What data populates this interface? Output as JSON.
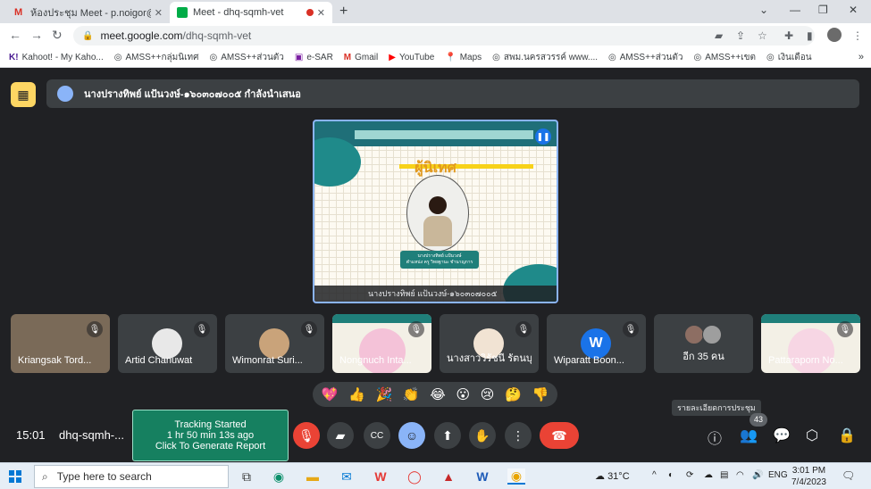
{
  "browser": {
    "tabs": [
      {
        "title": "ห้องประชุม Meet - p.noigor@gmail",
        "active": false
      },
      {
        "title": "Meet - dhq-sqmh-vet",
        "active": true
      }
    ],
    "url": {
      "host": "meet.google.com",
      "path": "/dhq-sqmh-vet"
    },
    "bookmarks": [
      {
        "label": "Kahoot! - My Kaho...",
        "icon": "K!"
      },
      {
        "label": "AMSS++กลุ่มนิเทศ",
        "icon": "◎"
      },
      {
        "label": "AMSS++ส่วนตัว",
        "icon": "◎"
      },
      {
        "label": "e-SAR",
        "icon": "▣"
      },
      {
        "label": "Gmail",
        "icon": "M"
      },
      {
        "label": "YouTube",
        "icon": "▶"
      },
      {
        "label": "Maps",
        "icon": "📍"
      },
      {
        "label": "สพม.นครสวรรค์ www....",
        "icon": "◎"
      },
      {
        "label": "AMSS++ส่วนตัว",
        "icon": "◎"
      },
      {
        "label": "AMSS++เขต",
        "icon": "◎"
      },
      {
        "label": "เงินเดือน",
        "icon": "◎"
      }
    ]
  },
  "meet": {
    "presenter_banner": "นางปรางทิพย์ แป้นวงษ์-๑๖๐๓๐๗๐๐๕ กำลังนำเสนอ",
    "slide": {
      "title": "ผู้นิเทศ",
      "caption_name": "นางปรางทิพย์ แป้นวงษ์",
      "caption_role": "ตำแหน่ง ครู วิทยฐานะ ชำนาญการ",
      "footer": "นางปรางทิพย์ แป้นวงษ์-๑๖๐๓๐๗๐๐๕"
    },
    "participants": [
      {
        "name": "Kriangsak Tord...",
        "kind": "video"
      },
      {
        "name": "Artid Chanuwat",
        "kind": "avatar"
      },
      {
        "name": "Wimonrat Suri...",
        "kind": "avatar"
      },
      {
        "name": "Nongnuch Inta...",
        "kind": "slide"
      },
      {
        "name": "นางสาววิรัชนี รัตนบุรี",
        "kind": "avatar"
      },
      {
        "name": "Wiparatt Boon...",
        "kind": "letter",
        "letter": "W"
      },
      {
        "name": "อีก 35 คน",
        "kind": "more"
      },
      {
        "name": "Pattaraporn No...",
        "kind": "slide"
      }
    ],
    "reactions": [
      "💖",
      "👍",
      "🎉",
      "👏",
      "😂",
      "😮",
      "😢",
      "🤔",
      "👎"
    ],
    "tooltip": "รายละเอียดการประชุม",
    "people_count": "43",
    "time": "15:01",
    "meeting_code": "dhq-sqmh-...",
    "tracking": {
      "line1": "Tracking Started",
      "line2": "1 hr 50 min 13s ago",
      "line3": "Click To Generate Report"
    }
  },
  "taskbar": {
    "search_placeholder": "Type here to search",
    "weather": "31°C",
    "language": "ENG",
    "time": "3:01 PM",
    "date": "7/4/2023"
  },
  "colors": {
    "meet_bg": "#202124",
    "end_call": "#ea4335",
    "active_blue": "#8ab4f8",
    "tracking_green": "#168060"
  }
}
